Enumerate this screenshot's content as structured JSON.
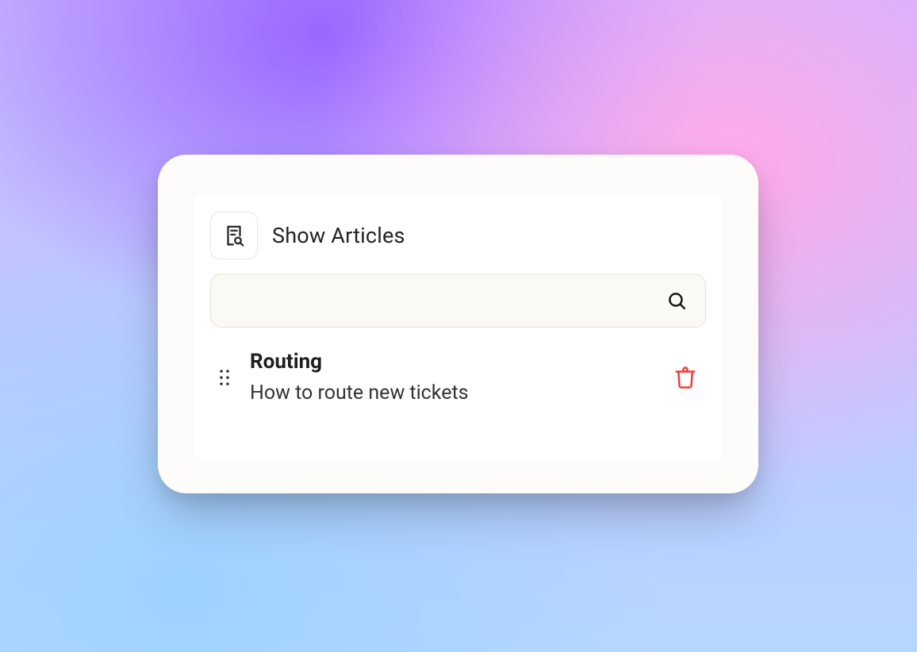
{
  "header": {
    "title": "Show Articles"
  },
  "search": {
    "value": "",
    "placeholder": ""
  },
  "items": [
    {
      "title": "Routing",
      "subtitle": "How to route new tickets"
    }
  ]
}
